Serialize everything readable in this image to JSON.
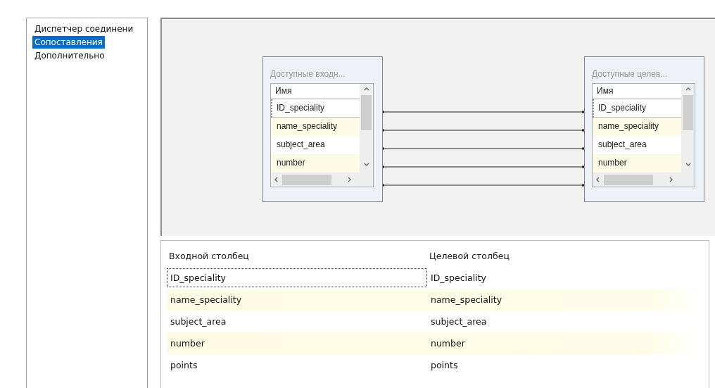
{
  "nav": {
    "items": [
      {
        "label": "Диспетчер соединени",
        "selected": false
      },
      {
        "label": "Сопоставления",
        "selected": true
      },
      {
        "label": "Дополнительно",
        "selected": false
      }
    ]
  },
  "mapping": {
    "boxes": [
      {
        "title": "Доступные входн...",
        "header": "Имя",
        "rows": [
          {
            "name": "ID_speciality",
            "focused": true
          },
          {
            "name": "name_speciality",
            "focused": false
          },
          {
            "name": "subject_area",
            "focused": false
          },
          {
            "name": "number",
            "focused": false
          }
        ]
      },
      {
        "title": "Доступные целев...",
        "header": "Имя",
        "rows": [
          {
            "name": "ID_speciality",
            "focused": true
          },
          {
            "name": "name_speciality",
            "focused": false
          },
          {
            "name": "subject_area",
            "focused": false
          },
          {
            "name": "number",
            "focused": false
          }
        ]
      }
    ]
  },
  "table": {
    "columns": [
      "Входной столбец",
      "Целевой столбец"
    ],
    "rows": [
      {
        "input": "ID_speciality",
        "target": "ID_speciality",
        "focused": true
      },
      {
        "input": "name_speciality",
        "target": "name_speciality",
        "focused": false
      },
      {
        "input": "subject_area",
        "target": "subject_area",
        "focused": false
      },
      {
        "input": "number",
        "target": "number",
        "focused": false
      },
      {
        "input": "points",
        "target": "points",
        "focused": false
      }
    ]
  }
}
